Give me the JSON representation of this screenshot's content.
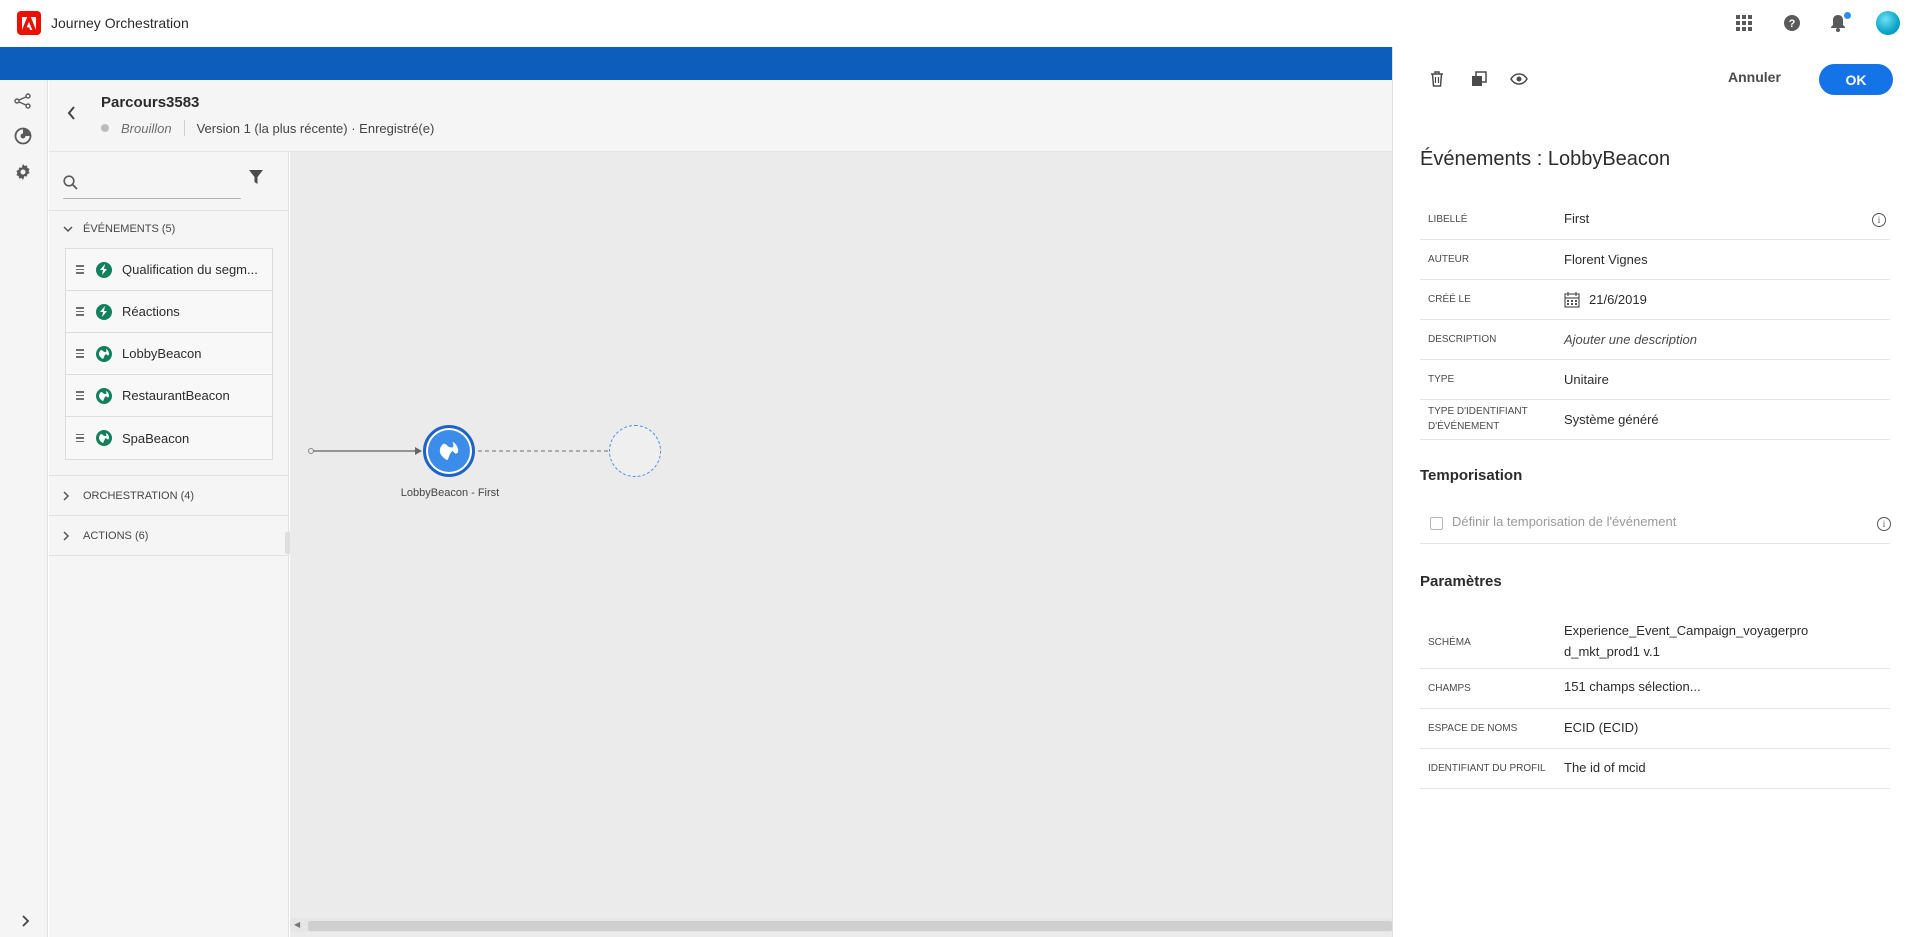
{
  "app": {
    "title": "Journey Orchestration"
  },
  "header": {
    "journey_name": "Parcours3583",
    "status": "Brouillon",
    "version": "Version 1 (la plus récente) · Enregistré(e)"
  },
  "palette": {
    "search_placeholder": "",
    "events_title": "ÉVÉNEMENTS (5)",
    "events": [
      "Qualification du segm...",
      "Réactions",
      "LobbyBeacon",
      "RestaurantBeacon",
      "SpaBeacon"
    ],
    "orchestration_title": "ORCHESTRATION (4)",
    "actions_title": "ACTIONS (6)"
  },
  "canvas": {
    "node_label": "LobbyBeacon - First"
  },
  "panel": {
    "cancel_label": "Annuler",
    "ok_label": "OK",
    "title": "Événements : LobbyBeacon",
    "fields": {
      "label": {
        "name": "LIBELLÉ",
        "value": "First"
      },
      "author": {
        "name": "AUTEUR",
        "value": "Florent Vignes"
      },
      "created": {
        "name": "CRÉÉ LE",
        "value": "21/6/2019"
      },
      "description": {
        "name": "DESCRIPTION",
        "value": "Ajouter une description"
      },
      "type": {
        "name": "TYPE",
        "value": "Unitaire"
      },
      "id_type": {
        "name_line1": "TYPE D'IDENTIFIANT",
        "name_line2": "D'ÉVÉNEMENT",
        "value": "Système généré"
      }
    },
    "timing_heading": "Temporisation",
    "timing_checkbox": "Définir la temporisation de l'événement",
    "params_heading": "Paramètres",
    "params": {
      "schema": {
        "name": "SCHÉMA",
        "value_line1": "Experience_Event_Campaign_voyagerpro",
        "value_line2": "d_mkt_prod1 v.1"
      },
      "fields": {
        "name": "CHAMPS",
        "value": "151 champs sélection..."
      },
      "namespace": {
        "name": "ESPACE DE NOMS",
        "value": "ECID (ECID)"
      },
      "profile_id": {
        "name": "IDENTIFIANT DU PROFIL",
        "value": "The id of mcid"
      }
    }
  },
  "colors": {
    "brand_band": "#0d5dbd",
    "primary": "#1473e6",
    "event_icon": "#12805c",
    "adobe_red": "#eb1000"
  }
}
